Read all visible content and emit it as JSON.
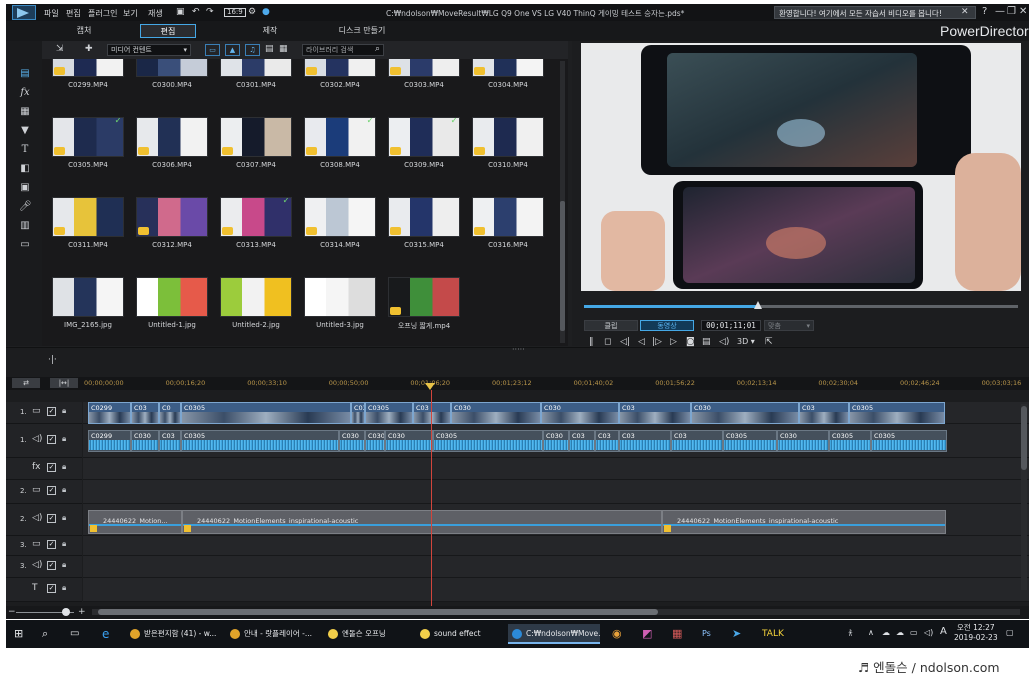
{
  "titlebar": {
    "menu": [
      "파일",
      "편집",
      "플러그인",
      "보기",
      "재생"
    ],
    "title": "C:₩ndolson₩MoveResult₩LG Q9 One VS LG V40 ThinQ 게이밍 테스트 승자는.pds*",
    "notification": "환영합니다! 여기에서 모든 자습서 비디오를 봅니다!",
    "notification_close": "✕",
    "window_controls": [
      "?",
      "—",
      "❐",
      "✕"
    ]
  },
  "modes": {
    "tabs": [
      "캡처",
      "편집",
      "제작",
      "디스크 만들기"
    ],
    "active": "편집",
    "brand": "PowerDirector"
  },
  "library": {
    "filter": "미디어 컨텐트",
    "search_placeholder": "라이브러리 검색",
    "items": [
      {
        "label": "C0299.MP4",
        "colors": [
          "#d7dbe0",
          "#1e2a52",
          "#f2f2f2"
        ],
        "badge": true,
        "check": false
      },
      {
        "label": "C0300.MP4",
        "colors": [
          "#1a2747",
          "#3a4f7a",
          "#c5ccd8"
        ],
        "badge": false,
        "check": false
      },
      {
        "label": "C0301.MP4",
        "colors": [
          "#dfe3e8",
          "#2c3c68",
          "#eaeaea"
        ],
        "badge": false,
        "check": false
      },
      {
        "label": "C0302.MP4",
        "colors": [
          "#d8dde3",
          "#243360",
          "#f0f0f0"
        ],
        "badge": true,
        "check": false
      },
      {
        "label": "C0303.MP4",
        "colors": [
          "#dde1e6",
          "#2b3b6a",
          "#eeeeee"
        ],
        "badge": true,
        "check": false
      },
      {
        "label": "C0304.MP4",
        "colors": [
          "#e1e4e8",
          "#203058",
          "#f4f4f4"
        ],
        "badge": true,
        "check": false
      },
      {
        "label": "C0305.MP4",
        "colors": [
          "#e4e6ea",
          "#1e2b4e",
          "#2b3b66"
        ],
        "badge": true,
        "check": true
      },
      {
        "label": "C0306.MP4",
        "colors": [
          "#e7e9ec",
          "#213055",
          "#f2f2f2"
        ],
        "badge": true,
        "check": false
      },
      {
        "label": "C0307.MP4",
        "colors": [
          "#eceef0",
          "#151b2b",
          "#c9b9a6"
        ],
        "badge": true,
        "check": false
      },
      {
        "label": "C0308.MP4",
        "colors": [
          "#e8eaee",
          "#1b3c7a",
          "#f1f1f1"
        ],
        "badge": true,
        "check": true
      },
      {
        "label": "C0309.MP4",
        "colors": [
          "#eceef1",
          "#1f2d58",
          "#e9e9e9"
        ],
        "badge": true,
        "check": true
      },
      {
        "label": "C0310.MP4",
        "colors": [
          "#e9ebee",
          "#1e2a50",
          "#f0f0f0"
        ],
        "badge": true,
        "check": false
      },
      {
        "label": "C0311.MP4",
        "colors": [
          "#e6e8eb",
          "#e7c33a",
          "#1f2f54"
        ],
        "badge": true,
        "check": false
      },
      {
        "label": "C0312.MP4",
        "colors": [
          "#27305a",
          "#d06a8c",
          "#6a4aa8"
        ],
        "badge": true,
        "check": false
      },
      {
        "label": "C0313.MP4",
        "colors": [
          "#ebecee",
          "#c8498a",
          "#30306a"
        ],
        "badge": true,
        "check": true
      },
      {
        "label": "C0314.MP4",
        "colors": [
          "#eff0f2",
          "#bcc7d4",
          "#f5f5f5"
        ],
        "badge": true,
        "check": false
      },
      {
        "label": "C0315.MP4",
        "colors": [
          "#e9ebee",
          "#24356a",
          "#eeeeee"
        ],
        "badge": true,
        "check": false
      },
      {
        "label": "C0316.MP4",
        "colors": [
          "#eef0f2",
          "#2c3f6e",
          "#f3f3f3"
        ],
        "badge": true,
        "check": false
      },
      {
        "label": "IMG_2165.jpg",
        "colors": [
          "#dfe2e6",
          "#24345a",
          "#f5f5f5"
        ],
        "badge": false,
        "check": false
      },
      {
        "label": "Untitled-1.jpg",
        "colors": [
          "#ffffff",
          "#7cbf3a",
          "#e65a4a"
        ],
        "badge": false,
        "check": false
      },
      {
        "label": "Untitled-2.jpg",
        "colors": [
          "#9ccc3c",
          "#f2f2f2",
          "#f0c020"
        ],
        "badge": false,
        "check": false
      },
      {
        "label": "Untitled-3.jpg",
        "colors": [
          "#ffffff",
          "#f5f5f5",
          "#dddddd"
        ],
        "badge": false,
        "check": false
      },
      {
        "label": "오프닝 짧게.mp4",
        "colors": [
          "#181a1c",
          "#3f8f3a",
          "#c44a4a"
        ],
        "badge": true,
        "check": false
      }
    ]
  },
  "preview": {
    "tab_clip": "클립",
    "tab_movie": "동영상",
    "timecode": "00;01;11;01",
    "quality": "맞춤",
    "progress": 0.4
  },
  "timeline": {
    "ruler": [
      "00;00;00;00",
      "00;00;16;20",
      "00;00;33;10",
      "00;00;50;00",
      "00;01;06;20",
      "00;01;23;12",
      "00;01;40;02",
      "00;01;56;22",
      "00;02;13;14",
      "00;02;30;04",
      "00;02;46;24",
      "00;03;03;16"
    ],
    "tracks": [
      {
        "label": "1.",
        "type": "video"
      },
      {
        "label": "1.",
        "type": "audio"
      },
      {
        "label": "",
        "type": "fx"
      },
      {
        "label": "2.",
        "type": "video"
      },
      {
        "label": "2.",
        "type": "audio"
      },
      {
        "label": "3.",
        "type": "video"
      },
      {
        "label": "3.",
        "type": "audio"
      },
      {
        "label": "",
        "type": "title"
      }
    ],
    "video_clips": [
      "C0299",
      "C03",
      "C0",
      "C0305",
      "C030",
      "C0305",
      "C03",
      "C030",
      "C030",
      "C03",
      "C030",
      "C03",
      "C0305"
    ],
    "audio_clips": [
      "C0299",
      "C030",
      "C03",
      "C0305",
      "C030",
      "C0305",
      "C030",
      "C0305",
      "C030",
      "C03",
      "C03",
      "C03",
      "C03",
      "C0305",
      "C030",
      "C0305",
      "C0305"
    ],
    "music_clips": [
      "24440622_Motion...",
      "24440622_MotionElements_inspirational-acoustic",
      "24440622_MotionElements_inspirational-acoustic"
    ]
  },
  "taskbar": {
    "apps": [
      {
        "label": "받은편지함 (41) - w...",
        "color": "#e0a32a"
      },
      {
        "label": "안내 - 랏플레이어 -...",
        "color": "#e0a32a"
      },
      {
        "label": "엔돌슨 오프닝",
        "color": "#f2cf4a"
      },
      {
        "label": "sound effect",
        "color": "#f2cf4a"
      },
      {
        "label": "C:₩ndolson₩Move...",
        "color": "#2c8ad8"
      }
    ],
    "time": "오전 12:27",
    "date": "2019-02-23",
    "ime": "A"
  },
  "watermark": "♬ 엔돌슨 / ndolson.com"
}
